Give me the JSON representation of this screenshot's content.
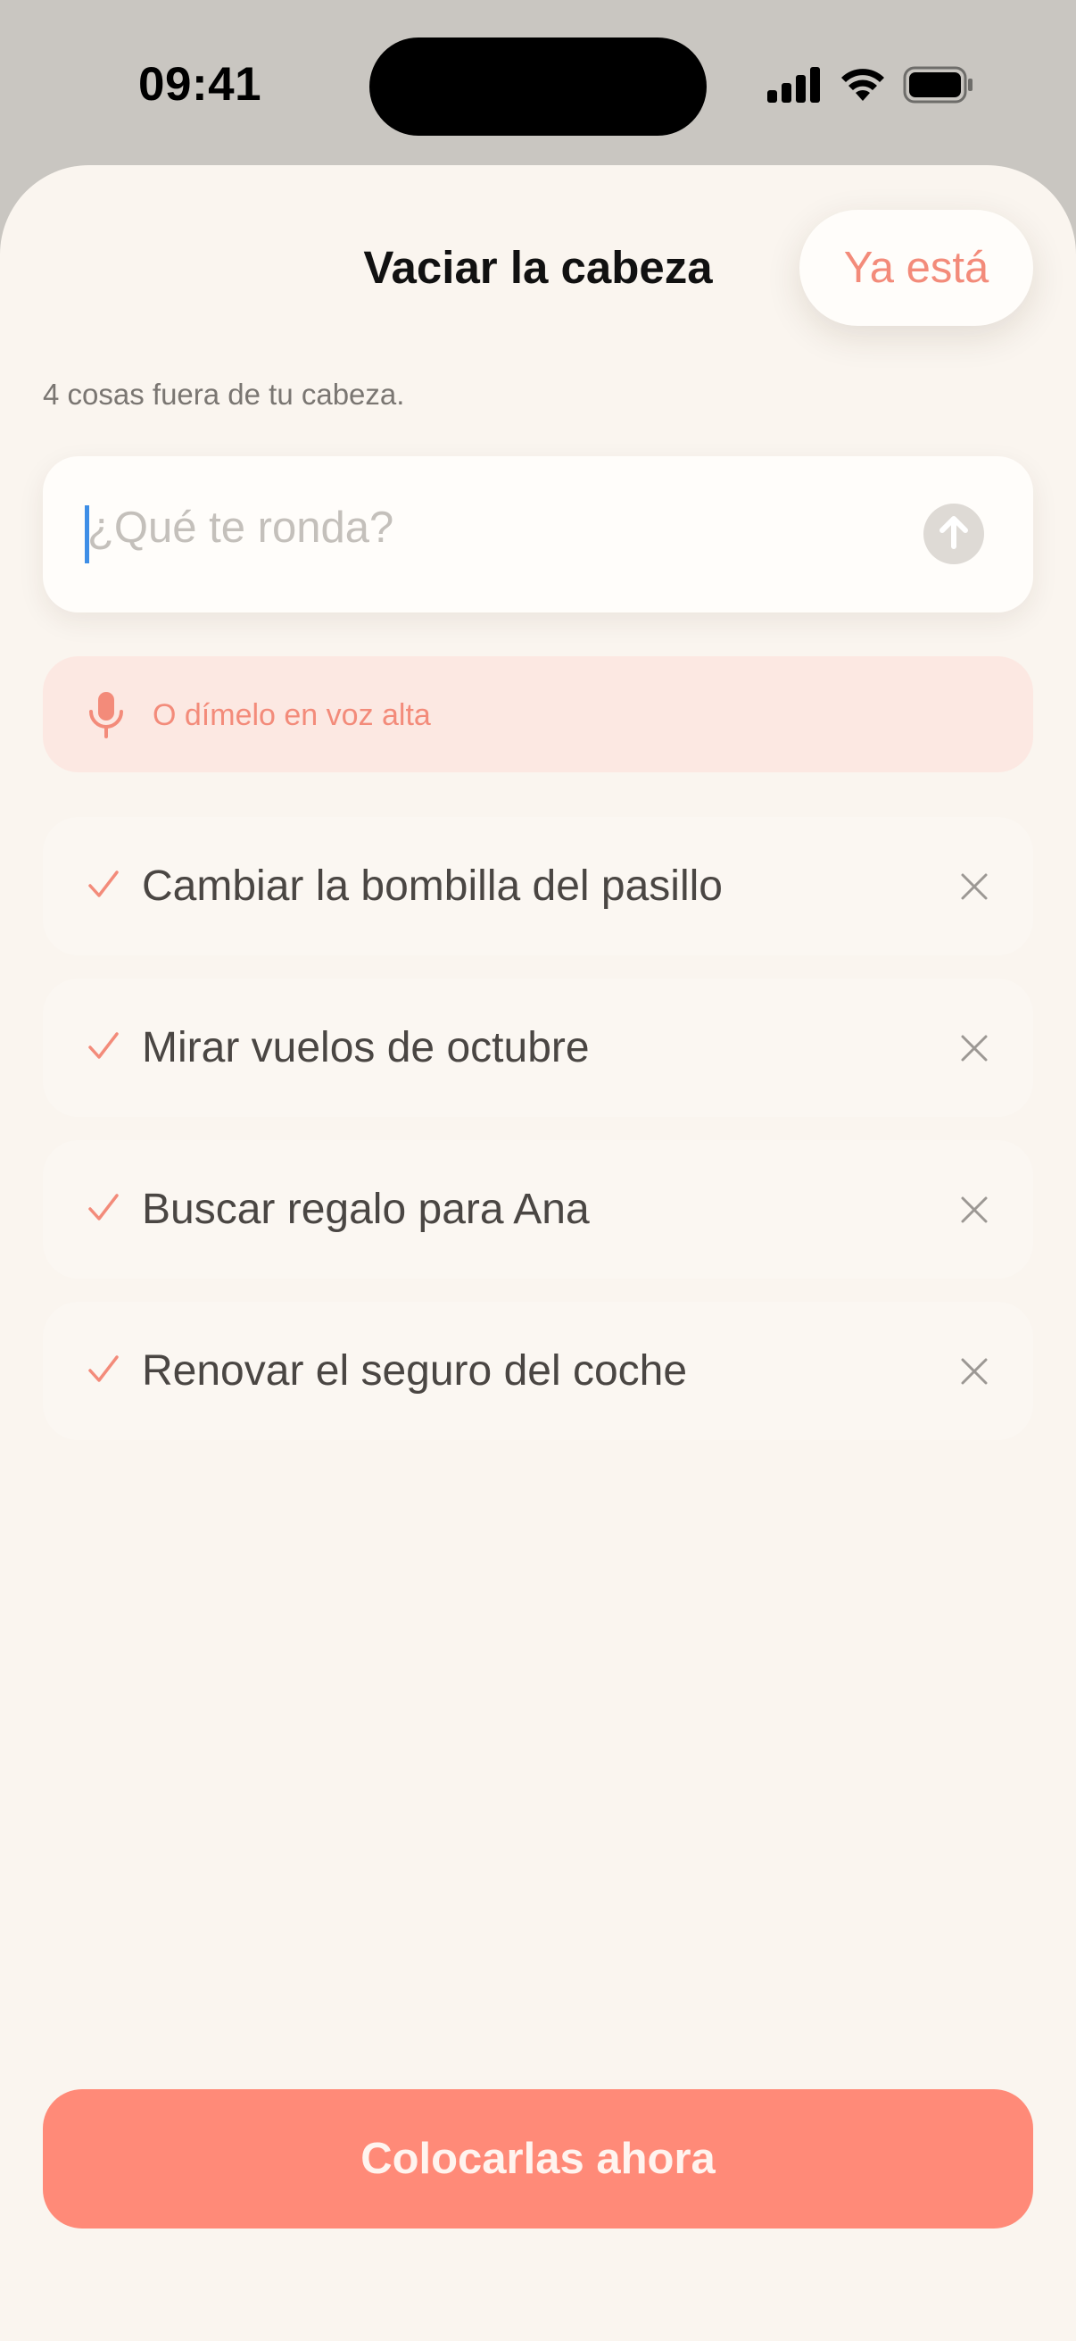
{
  "status_bar": {
    "time": "09:41"
  },
  "header": {
    "title": "Vaciar la cabeza",
    "done_label": "Ya está"
  },
  "subtitle": "4 cosas fuera de tu cabeza.",
  "input": {
    "placeholder": "¿Qué te ronda?",
    "value": "",
    "send_icon": "arrow-up-icon"
  },
  "voice": {
    "label": "O dímelo en voz alta",
    "icon": "microphone-icon"
  },
  "items": [
    {
      "label": "Cambiar la bombilla del pasillo",
      "checked": true
    },
    {
      "label": "Mirar vuelos de octubre",
      "checked": true
    },
    {
      "label": "Buscar regalo para Ana",
      "checked": true
    },
    {
      "label": "Renovar el seguro del coche",
      "checked": true
    }
  ],
  "primary_action": {
    "label": "Colocarlas ahora"
  },
  "colors": {
    "accent": "#ff8a78",
    "accent_text": "#f38b7a",
    "background": "#faf5ef",
    "voice_background": "#fce8e2"
  }
}
